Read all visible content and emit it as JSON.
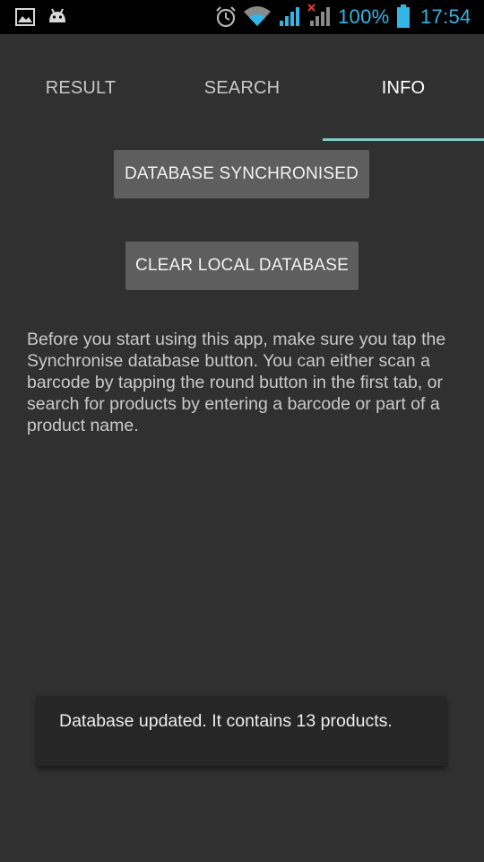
{
  "status_bar": {
    "left_icons": [
      "image-icon",
      "android-icon"
    ],
    "right_icons": [
      "alarm-icon",
      "wifi-icon",
      "signal-icon",
      "signal-no-data-icon",
      "battery-icon"
    ],
    "battery_percent": "100%",
    "time": "17:54",
    "accent_color": "#33b5e5"
  },
  "tabs": [
    {
      "label": "RESULT",
      "active": false
    },
    {
      "label": "SEARCH",
      "active": false
    },
    {
      "label": "INFO",
      "active": true
    }
  ],
  "tab_indicator_color": "#7fcac3",
  "buttons": {
    "sync_label": "DATABASE SYNCHRONISED",
    "clear_label": "CLEAR LOCAL DATABASE"
  },
  "info": {
    "text": "Before you start using this app, make sure you tap the Synchronise database button. You can either scan a barcode by tapping the round button in the first tab, or search for products by entering a barcode or part of a product name."
  },
  "toast": {
    "message": "Database updated. It contains 13 products."
  }
}
